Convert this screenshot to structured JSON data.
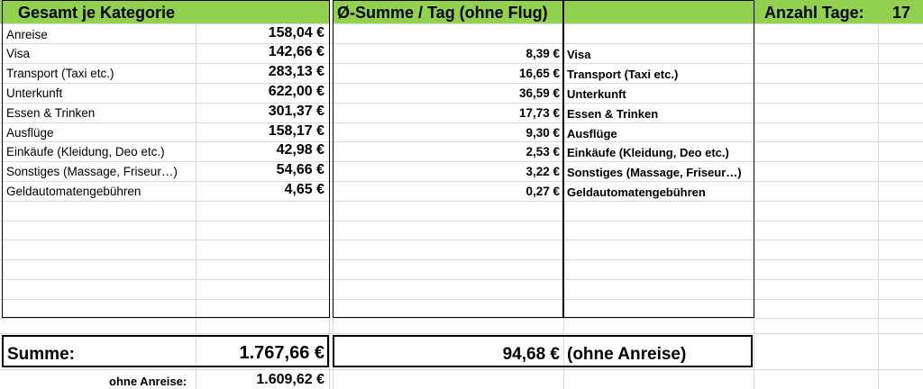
{
  "header": {
    "category_title": "Gesamt je Kategorie",
    "avg_title": "Ø-Summe / Tag (ohne Flug)",
    "days_label": "Anzahl Tage:",
    "days_value": "17"
  },
  "categories": [
    {
      "label": "Anreise",
      "amount": "158,04 €",
      "avg": "",
      "avg_label": ""
    },
    {
      "label": "Visa",
      "amount": "142,66 €",
      "avg": "8,39 €",
      "avg_label": "Visa"
    },
    {
      "label": "Transport (Taxi etc.)",
      "amount": "283,13 €",
      "avg": "16,65 €",
      "avg_label": "Transport (Taxi etc.)"
    },
    {
      "label": "Unterkunft",
      "amount": "622,00 €",
      "avg": "36,59 €",
      "avg_label": "Unterkunft"
    },
    {
      "label": "Essen & Trinken",
      "amount": "301,37 €",
      "avg": "17,73 €",
      "avg_label": "Essen & Trinken"
    },
    {
      "label": "Ausflüge",
      "amount": "158,17 €",
      "avg": "9,30 €",
      "avg_label": "Ausflüge"
    },
    {
      "label": "Einkäufe (Kleidung, Deo etc.)",
      "amount": "42,98 €",
      "avg": "2,53 €",
      "avg_label": "Einkäufe (Kleidung, Deo etc.)"
    },
    {
      "label": "Sonstiges (Massage, Friseur…)",
      "amount": "54,66 €",
      "avg": "3,22 €",
      "avg_label": "Sonstiges (Massage, Friseur…)"
    },
    {
      "label": "Geldautomatengebühren",
      "amount": "4,65 €",
      "avg": "0,27 €",
      "avg_label": "Geldautomatengebühren"
    }
  ],
  "summary": {
    "sum_label": "Summe:",
    "sum_value": "1.767,66 €",
    "avg_sum_value": "94,68 €",
    "avg_sum_note": "(ohne Anreise)",
    "ohne_label": "ohne Anreise:",
    "ohne_value": "1.609,62 €"
  },
  "colors": {
    "header_fill": "#92d050",
    "grid": "#d9d9d9",
    "border": "#000000"
  }
}
